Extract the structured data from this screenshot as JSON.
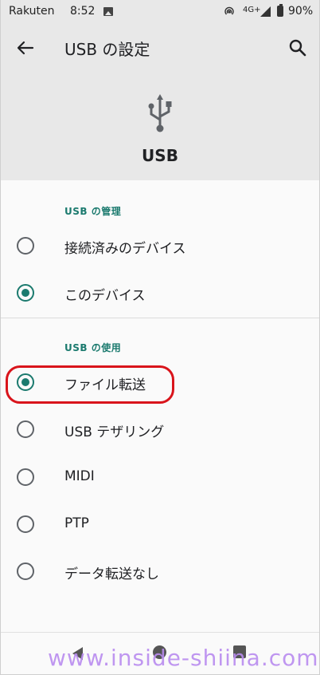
{
  "status_bar": {
    "carrier": "Rakuten",
    "time": "8:52",
    "network": "4G+",
    "battery": "90%"
  },
  "app_bar": {
    "title": "USB の設定",
    "back_icon": "arrow-back-icon",
    "search_icon": "search-icon"
  },
  "hero": {
    "icon": "usb-icon",
    "label": "USB"
  },
  "section_manage": {
    "title": "USB の管理",
    "options": [
      {
        "label": "接続済みのデバイス",
        "selected": false
      },
      {
        "label": "このデバイス",
        "selected": true
      }
    ]
  },
  "section_use": {
    "title": "USB の使用",
    "options": [
      {
        "label": "ファイル転送",
        "selected": true
      },
      {
        "label": "USB テザリング",
        "selected": false
      },
      {
        "label": "MIDI",
        "selected": false
      },
      {
        "label": "PTP",
        "selected": false
      },
      {
        "label": "データ転送なし",
        "selected": false
      }
    ]
  },
  "colors": {
    "accent": "#1b7a6e",
    "highlight": "#d9141b"
  },
  "watermark": "www.inside-shiina.com"
}
